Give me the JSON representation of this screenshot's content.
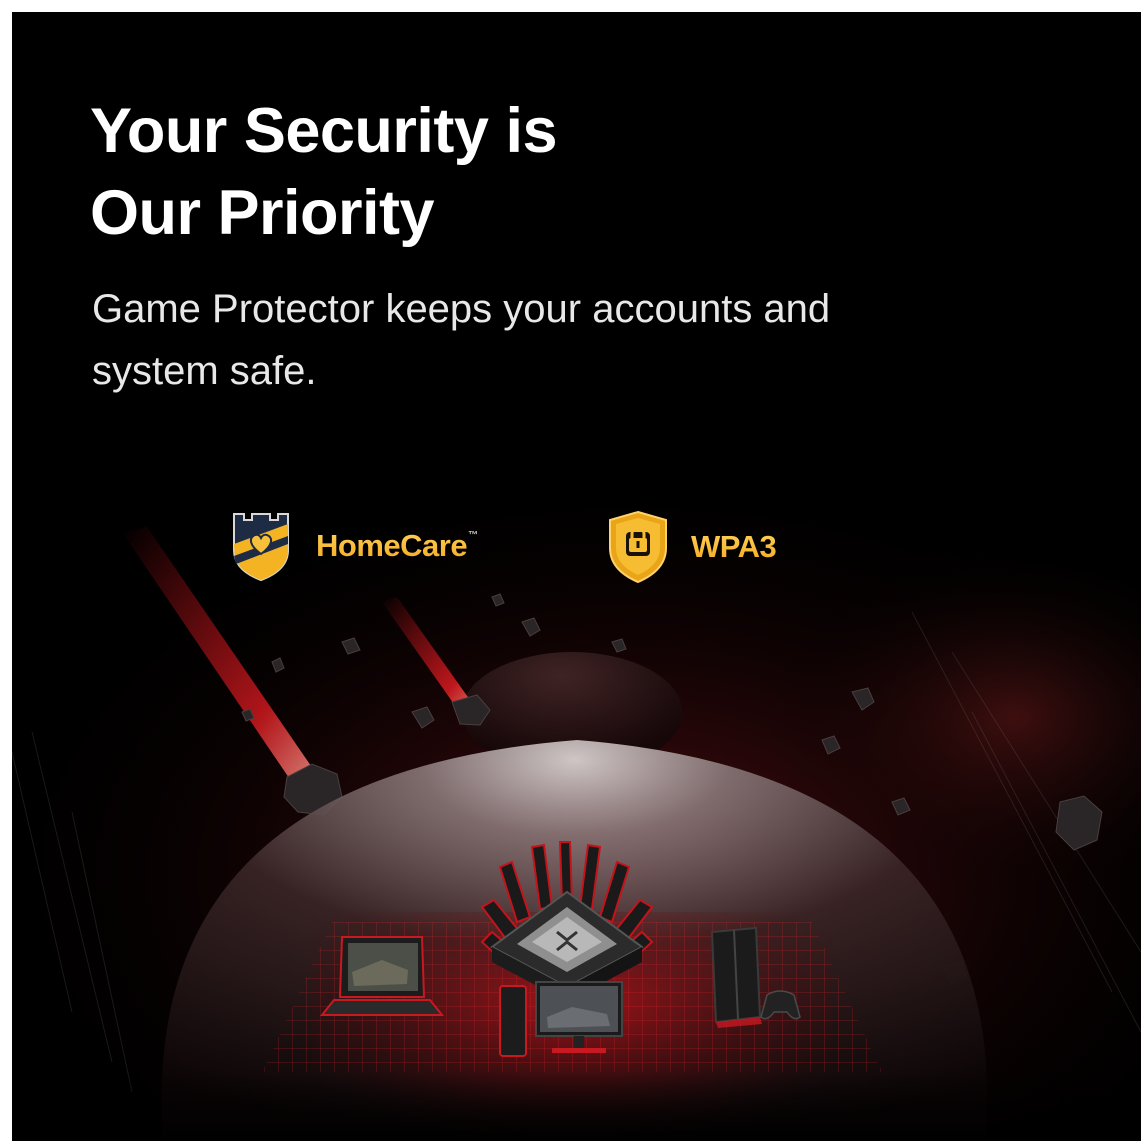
{
  "headline": {
    "line1": "Your Security is",
    "line2": "Our Priority"
  },
  "subline": {
    "line1": "Game Protector keeps your accounts and",
    "line2": "system safe."
  },
  "badges": [
    {
      "label": "HomeCare",
      "trademark": "™",
      "icon": "homecare-shield-icon"
    },
    {
      "label": "WPA3",
      "icon": "padlock-shield-icon"
    }
  ],
  "colors": {
    "background": "#000000",
    "accent_red": "#e0141e",
    "badge_gold": "#f0b323",
    "text": "#ffffff"
  }
}
